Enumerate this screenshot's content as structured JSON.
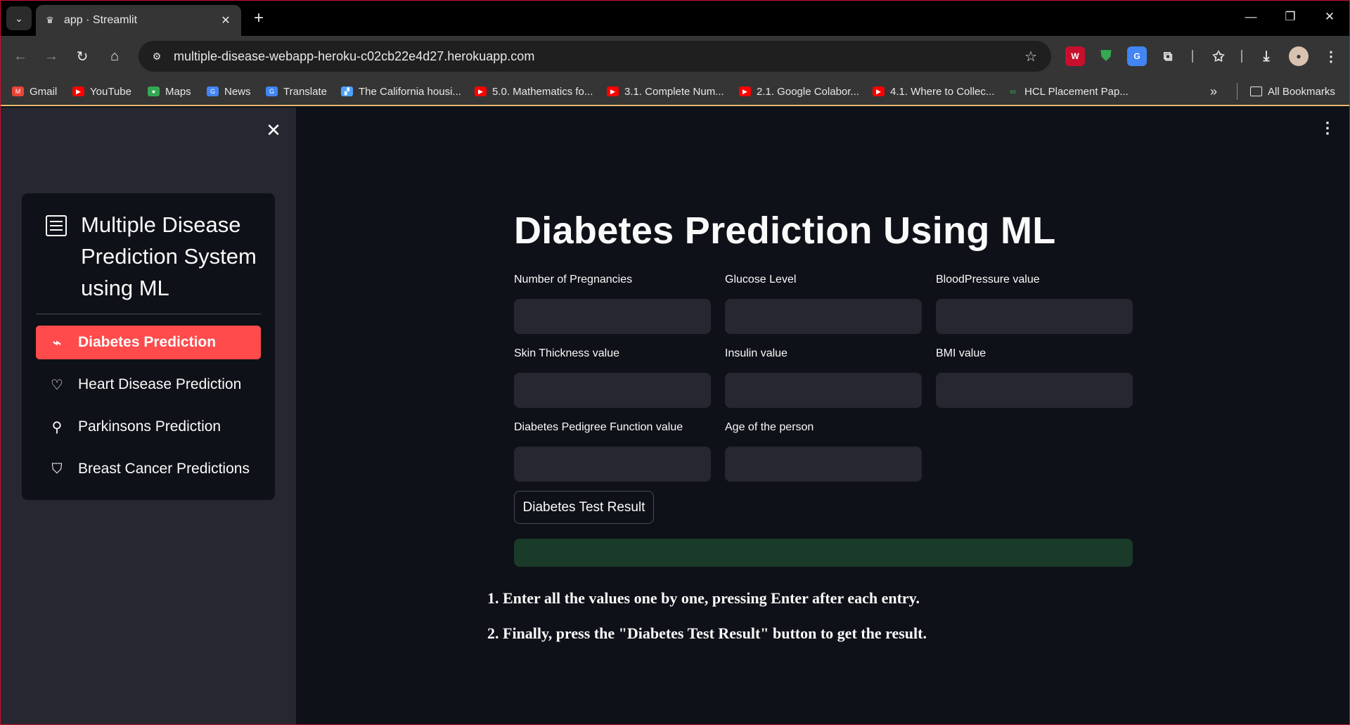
{
  "browser": {
    "tab": {
      "title": "app · Streamlit"
    },
    "url": "multiple-disease-webapp-heroku-c02cb22e4d27.herokuapp.com",
    "bookmarks": [
      {
        "label": "Gmail",
        "icon": "gmail-icon"
      },
      {
        "label": "YouTube",
        "icon": "youtube-icon"
      },
      {
        "label": "Maps",
        "icon": "maps-icon"
      },
      {
        "label": "News",
        "icon": "news-icon"
      },
      {
        "label": "Translate",
        "icon": "translate-icon"
      },
      {
        "label": "The California housi...",
        "icon": "page-icon"
      },
      {
        "label": "5.0. Mathematics fo...",
        "icon": "youtube-icon"
      },
      {
        "label": "3.1. Complete Num...",
        "icon": "youtube-icon"
      },
      {
        "label": "2.1. Google Colabor...",
        "icon": "youtube-icon"
      },
      {
        "label": "4.1. Where to Collec...",
        "icon": "youtube-icon"
      },
      {
        "label": "HCL Placement Pap...",
        "icon": "link-icon"
      }
    ],
    "all_bookmarks": "All Bookmarks"
  },
  "sidebar": {
    "menu_title": "Multiple Disease Prediction System using ML",
    "items": [
      {
        "label": "Diabetes Prediction",
        "icon": "activity-icon",
        "active": true
      },
      {
        "label": "Heart Disease Prediction",
        "icon": "heart-icon",
        "active": false
      },
      {
        "label": "Parkinsons Prediction",
        "icon": "person-icon",
        "active": false
      },
      {
        "label": "Breast Cancer Predictions",
        "icon": "bookmark-icon",
        "active": false
      }
    ]
  },
  "main": {
    "title": "Diabetes Prediction Using ML",
    "fields": [
      {
        "label": "Number of Pregnancies",
        "value": ""
      },
      {
        "label": "Glucose Level",
        "value": ""
      },
      {
        "label": "BloodPressure value",
        "value": ""
      },
      {
        "label": "Skin Thickness value",
        "value": ""
      },
      {
        "label": "Insulin value",
        "value": ""
      },
      {
        "label": "BMI value",
        "value": ""
      },
      {
        "label": "Diabetes Pedigree Function value",
        "value": ""
      },
      {
        "label": "Age of the person",
        "value": ""
      }
    ],
    "button_label": "Diabetes Test Result",
    "result_text": "",
    "instructions": [
      "1. Enter all the values one by one, pressing Enter after each entry.",
      "2. Finally, press the \"Diabetes Test Result\" button to get the result."
    ]
  },
  "colors": {
    "accent": "#ff4b4b",
    "background": "#0e1117",
    "sidebar": "#262730",
    "success_box": "#1a3a2a"
  }
}
